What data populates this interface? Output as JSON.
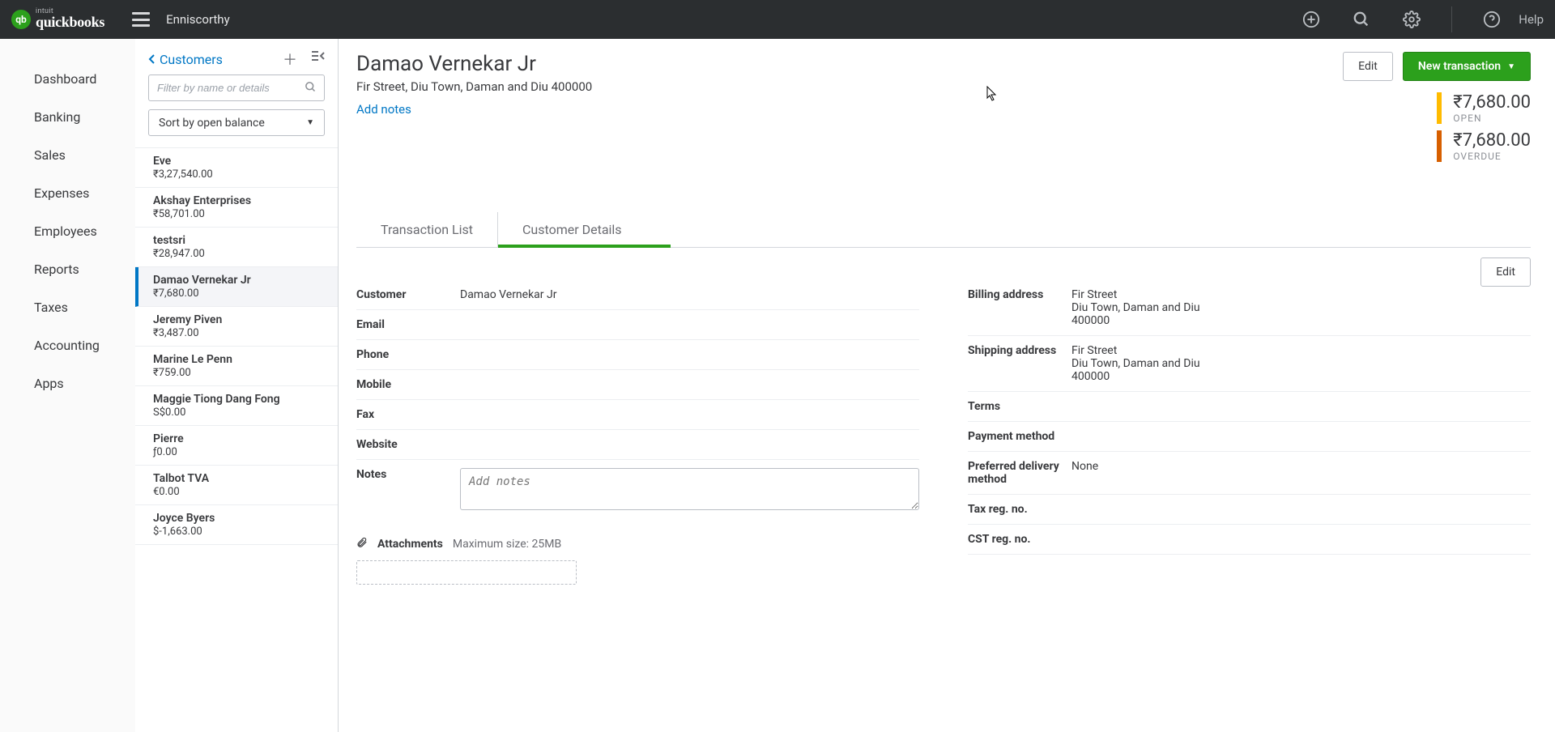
{
  "topbar": {
    "brand_small": "intuit",
    "brand": "quickbooks",
    "company": "Enniscorthy",
    "help": "Help"
  },
  "leftnav": {
    "items": [
      "Dashboard",
      "Banking",
      "Sales",
      "Expenses",
      "Employees",
      "Reports",
      "Taxes",
      "Accounting",
      "Apps"
    ]
  },
  "list": {
    "back_label": "Customers",
    "filter_placeholder": "Filter by name or details",
    "sort_label": "Sort by open balance",
    "customers": [
      {
        "name": "Eve",
        "balance": "₹3,27,540.00"
      },
      {
        "name": "Akshay Enterprises",
        "balance": "₹58,701.00"
      },
      {
        "name": "testsri",
        "balance": "₹28,947.00"
      },
      {
        "name": "Damao Vernekar Jr",
        "balance": "₹7,680.00",
        "selected": true
      },
      {
        "name": "Jeremy Piven",
        "balance": "₹3,487.00"
      },
      {
        "name": "Marine Le Penn",
        "balance": "₹759.00"
      },
      {
        "name": "Maggie Tiong Dang Fong",
        "balance": "S$0.00"
      },
      {
        "name": "Pierre",
        "balance": "ƒ0.00"
      },
      {
        "name": "Talbot TVA",
        "balance": "€0.00"
      },
      {
        "name": "Joyce Byers",
        "balance": "$-1,663.00"
      }
    ]
  },
  "detail": {
    "title": "Damao Vernekar Jr",
    "address_line": "Fir Street, Diu Town, Daman and Diu 400000",
    "add_notes": "Add notes",
    "edit_label": "Edit",
    "new_txn_label": "New transaction",
    "open": {
      "amount": "₹7,680.00",
      "label": "OPEN"
    },
    "overdue": {
      "amount": "₹7,680.00",
      "label": "OVERDUE"
    },
    "tabs": {
      "txn": "Transaction List",
      "details": "Customer Details"
    },
    "details_edit": "Edit",
    "left_fields": {
      "customer_label": "Customer",
      "customer_value": "Damao Vernekar Jr",
      "email_label": "Email",
      "email_value": "",
      "phone_label": "Phone",
      "phone_value": "",
      "mobile_label": "Mobile",
      "mobile_value": "",
      "fax_label": "Fax",
      "fax_value": "",
      "website_label": "Website",
      "website_value": "",
      "notes_label": "Notes",
      "notes_placeholder": "Add notes"
    },
    "right_fields": {
      "billing_label": "Billing address",
      "billing_l1": "Fir Street",
      "billing_l2": "Diu Town, Daman and Diu",
      "billing_l3": "400000",
      "shipping_label": "Shipping address",
      "shipping_l1": "Fir Street",
      "shipping_l2": "Diu Town, Daman and Diu",
      "shipping_l3": "400000",
      "terms_label": "Terms",
      "terms_value": "",
      "payment_label": "Payment method",
      "payment_value": "",
      "delivery_label": "Preferred delivery method",
      "delivery_value": "None",
      "taxreg_label": "Tax reg. no.",
      "taxreg_value": "",
      "cstreg_label": "CST reg. no.",
      "cstreg_value": ""
    },
    "attachments": {
      "label": "Attachments",
      "max": "Maximum size: 25MB"
    }
  }
}
